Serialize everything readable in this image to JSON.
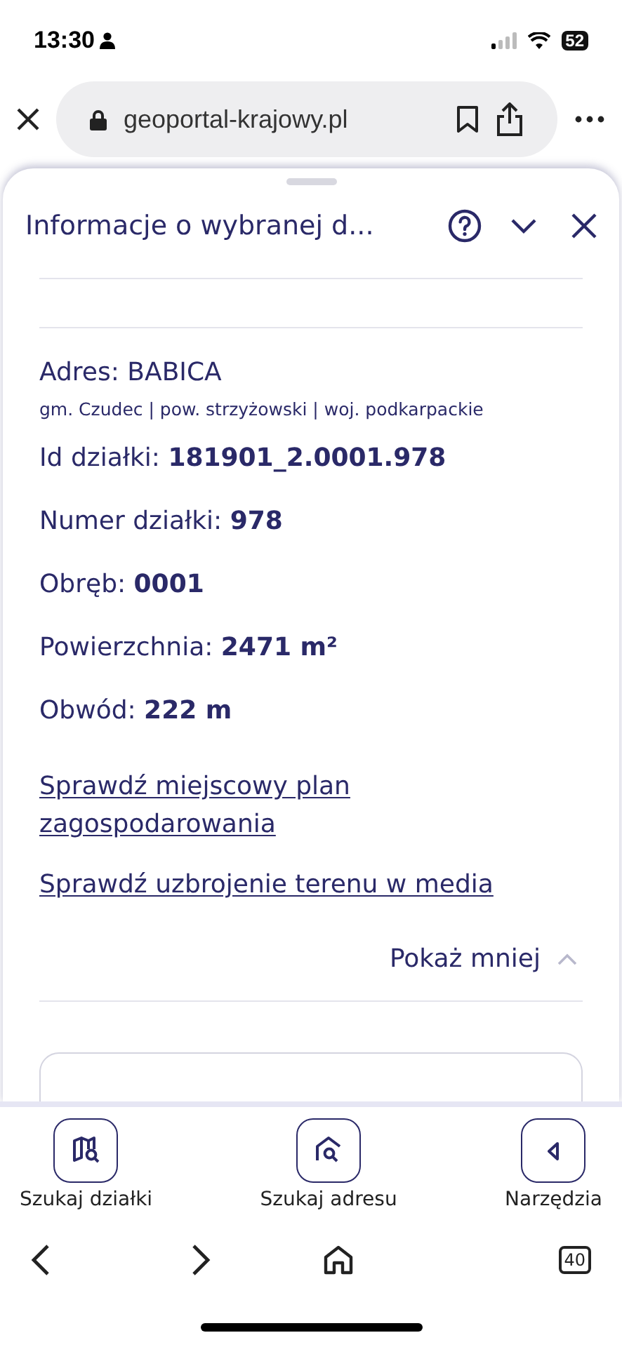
{
  "status_bar": {
    "time": "13:30",
    "battery": "52"
  },
  "browser": {
    "url": "geoportal-krajowy.pl",
    "tabs_count": "40"
  },
  "panel": {
    "title": "Informacje o wybranej d...",
    "address": {
      "title": "Adres: BABICA",
      "subtitle": "gm. Czudec | pow. strzyżowski | woj. podkarpackie"
    },
    "fields": [
      "Id działki: **181901_2.0001.978**",
      "Numer działki: **978**",
      "Obręb: **0001**",
      "Powierzchnia: **2471 m²**",
      "Obwód: **222 m**"
    ],
    "links": [
      "Sprawdź miejscowy plan zagospodarowania",
      "Sprawdź uzbrojenie terenu w media"
    ],
    "toggle": {
      "label": "Pokaż mniej",
      "expanded": true
    }
  },
  "bottom_nav": [
    {
      "kind": "parcel",
      "label": "Szukaj działki"
    },
    {
      "kind": "address",
      "label": "Szukaj adresu"
    },
    {
      "kind": "tools",
      "label": "Narzędzia"
    }
  ]
}
